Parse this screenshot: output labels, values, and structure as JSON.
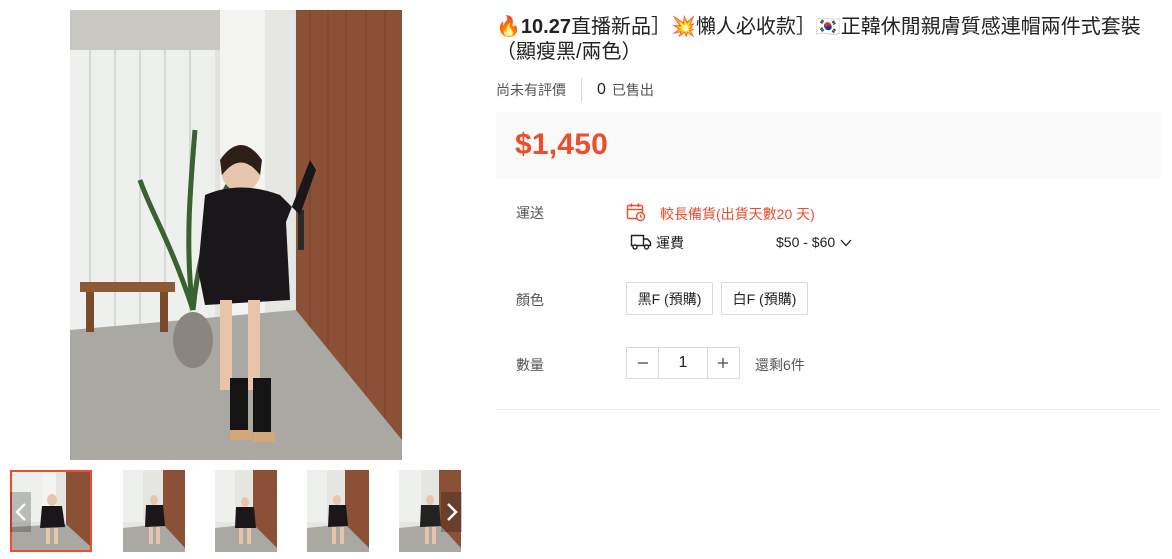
{
  "product": {
    "title_hot": "🔥10.27",
    "title_rest": "直播新品］💥懶人必收款］🇰🇷正韓休閒親膚質感連帽兩件式套裝（顯瘦黑/兩色）",
    "rating_text": "尚未有評價",
    "sold_count": "0",
    "sold_label": "已售出",
    "price": "$1,450"
  },
  "shipping": {
    "label": "運送",
    "warning": "較長備貨(出貨天數20 天)",
    "fee_label": "運費",
    "fee_value": "$50 - $60"
  },
  "variants": {
    "label": "顏色",
    "options": [
      "黑F (預購)",
      "白F (預購)"
    ]
  },
  "quantity": {
    "label": "數量",
    "value": "1",
    "stock_text": "還剩6件"
  },
  "gallery": {
    "thumbnail_count": 5,
    "active_index": 0
  },
  "colors": {
    "accent": "#ee4d2d",
    "price_bg": "#fafafa"
  },
  "icons": [
    "calendar-clock-icon",
    "truck-icon",
    "chevron-down-icon",
    "minus-icon",
    "plus-icon",
    "chevron-left-icon",
    "chevron-right-icon"
  ]
}
